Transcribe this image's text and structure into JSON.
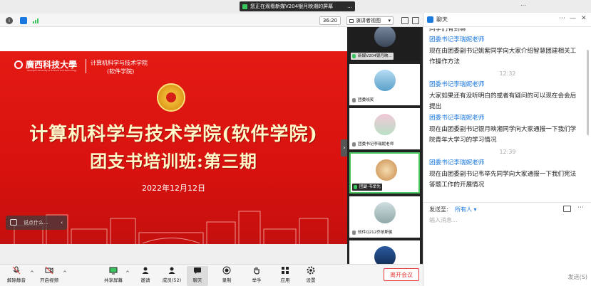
{
  "banner": {
    "text": "您正在观看新媒V204银月映湘的屏幕",
    "more": "…"
  },
  "meeting": {
    "timer": "36:20",
    "view_mode": "演讲者视图",
    "view_caret": "▾"
  },
  "slide": {
    "university": "廣西科技大學",
    "university_en": "Guangxi University of Science and Technology",
    "college_line1": "计算机科学与技术学院",
    "college_line2": "(软件学院)",
    "title_line1": "计算机科学与技术学院(软件学院)",
    "title_line2": "团支书培训班:第三期",
    "date": "2022年12月12日",
    "chat_placeholder": "说点什么...",
    "chat_pill_arrow": "‹"
  },
  "collapse_arrow": "›",
  "participants": [
    {
      "name": "新媒V204银月映...",
      "mic": "on",
      "selected": false
    },
    {
      "name": "团委晓笑",
      "mic": "off",
      "selected": false
    },
    {
      "name": "团委书记李瑞妮老师",
      "mic": "off",
      "selected": false
    },
    {
      "name": "团副-韦举先",
      "mic": "on",
      "selected": true
    },
    {
      "name": "软件Q212乔依斯俊",
      "mic": "off",
      "selected": false
    },
    {
      "name": "",
      "mic": "off",
      "selected": false
    }
  ],
  "chat": {
    "title": "聊天",
    "controls": {
      "more": "⋯",
      "minimize": "—",
      "close": "✕"
    },
    "messages": [
      {
        "kind": "text",
        "text": "同学们有到嘛"
      },
      {
        "kind": "sender",
        "text": "团委书记李瑞妮老师"
      },
      {
        "kind": "text",
        "text": "现在由团委副书记姚紫同学向大家介绍智慧团建相关工"
      },
      {
        "kind": "text",
        "text": "作操作方法"
      },
      {
        "kind": "time",
        "text": "12:32"
      },
      {
        "kind": "sender",
        "text": "团委书记李瑞妮老师"
      },
      {
        "kind": "text",
        "text": "大家如果还有没听明白的或者有疑问的可以现在会会后"
      },
      {
        "kind": "text",
        "text": "提出"
      },
      {
        "kind": "sender",
        "text": "团委书记李瑞妮老师"
      },
      {
        "kind": "text",
        "text": "现在由团委副书记银月映湘同学向大家通报一下我们学"
      },
      {
        "kind": "text",
        "text": "院青年大学习的学习情况"
      },
      {
        "kind": "time",
        "text": "12:39"
      },
      {
        "kind": "sender",
        "text": "团委书记李瑞妮老师"
      },
      {
        "kind": "text",
        "text": "现在由团委副书记韦举先同学向大家通报一下我们宪法"
      },
      {
        "kind": "text",
        "text": "答题工作的开展情况"
      }
    ],
    "send_to_label": "发送至:",
    "send_to_value": "所有人 ▾",
    "input_placeholder": "输入消息...",
    "send_button": "发送(S)",
    "options_icon": "⋯"
  },
  "toolbar": {
    "mute": "解除静音",
    "video": "开启视频",
    "share": "共享屏幕",
    "invite": "邀请",
    "members": "成员(52)",
    "chat": "聊天",
    "record": "录制",
    "raise_hand": "举手",
    "apps": "应用",
    "settings": "设置",
    "leave": "离开会议",
    "caret": "^"
  },
  "colors": {
    "accent": "#1b78e0",
    "slide_red": "#e41a14",
    "leave": "#e63a3a",
    "selected_border": "#4ac85f"
  }
}
